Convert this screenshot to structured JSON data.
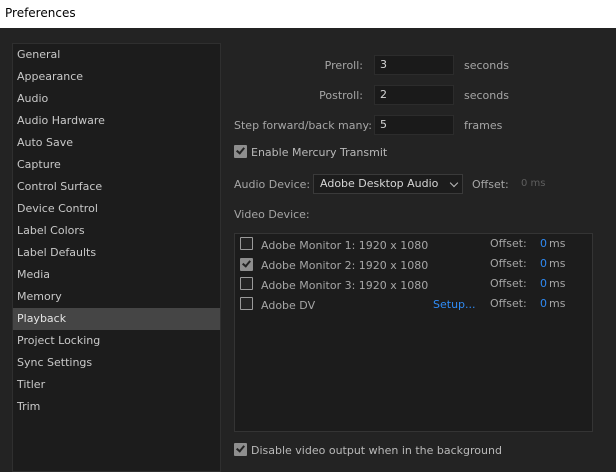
{
  "window": {
    "title": "Preferences"
  },
  "sidebar": {
    "items": [
      {
        "label": "General"
      },
      {
        "label": "Appearance"
      },
      {
        "label": "Audio"
      },
      {
        "label": "Audio Hardware"
      },
      {
        "label": "Auto Save"
      },
      {
        "label": "Capture"
      },
      {
        "label": "Control Surface"
      },
      {
        "label": "Device Control"
      },
      {
        "label": "Label Colors"
      },
      {
        "label": "Label Defaults"
      },
      {
        "label": "Media"
      },
      {
        "label": "Memory"
      },
      {
        "label": "Playback"
      },
      {
        "label": "Project Locking"
      },
      {
        "label": "Sync Settings"
      },
      {
        "label": "Titler"
      },
      {
        "label": "Trim"
      }
    ],
    "selected": "Playback"
  },
  "playback": {
    "preroll": {
      "label": "Preroll:",
      "value": "3",
      "unit": "seconds"
    },
    "postroll": {
      "label": "Postroll:",
      "value": "2",
      "unit": "seconds"
    },
    "step": {
      "label": "Step forward/back many:",
      "value": "5",
      "unit": "frames"
    },
    "mercury": {
      "label": "Enable Mercury Transmit",
      "checked": true
    },
    "audio_device": {
      "label": "Audio Device:",
      "value": "Adobe Desktop Audio",
      "offset_label": "Offset:",
      "offset_value": "0 ms"
    },
    "video_device": {
      "label": "Video Device:"
    },
    "video_devices": [
      {
        "name": "Adobe Monitor 1: 1920 x 1080",
        "checked": false,
        "offset_label": "Offset:",
        "offset_value": "0",
        "offset_unit": "ms"
      },
      {
        "name": "Adobe Monitor 2: 1920 x 1080",
        "checked": true,
        "offset_label": "Offset:",
        "offset_value": "0",
        "offset_unit": "ms"
      },
      {
        "name": "Adobe Monitor 3: 1920 x 1080",
        "checked": false,
        "offset_label": "Offset:",
        "offset_value": "0",
        "offset_unit": "ms"
      },
      {
        "name": "Adobe DV",
        "checked": false,
        "setup": "Setup...",
        "offset_label": "Offset:",
        "offset_value": "0",
        "offset_unit": "ms"
      }
    ],
    "disable_output": {
      "label": "Disable video output when in the background",
      "checked": true
    }
  }
}
